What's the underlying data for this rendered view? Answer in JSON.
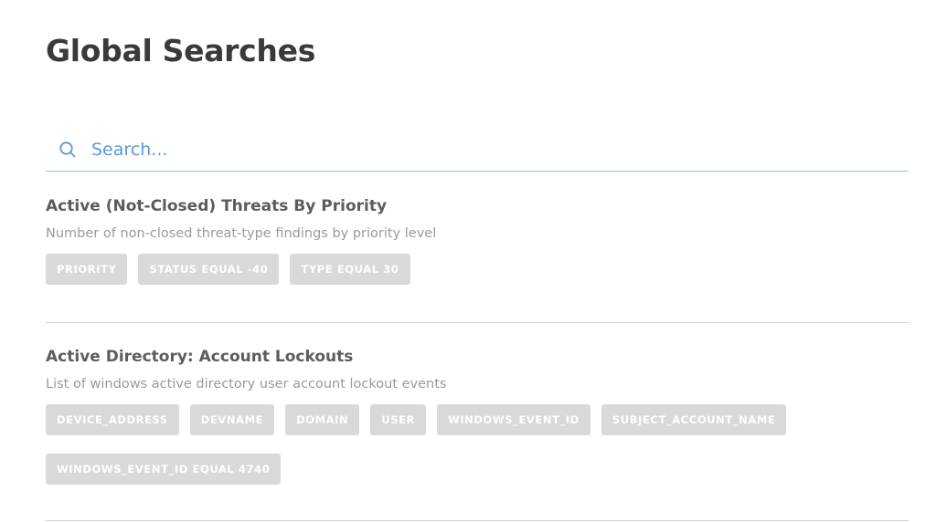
{
  "header": {
    "title": "Global Searches"
  },
  "search": {
    "placeholder": "Search...",
    "icon": "search-icon",
    "accent": "#5a9ad6"
  },
  "results": [
    {
      "title": "Active (Not-Closed) Threats By Priority",
      "description": "Number of non-closed threat-type findings by priority level",
      "tags": [
        "PRIORITY",
        "STATUS EQUAL -40",
        "TYPE EQUAL 30"
      ]
    },
    {
      "title": "Active Directory: Account Lockouts",
      "description": "List of windows active directory user account lockout events",
      "tags": [
        "DEVICE_ADDRESS",
        "DEVNAME",
        "DOMAIN",
        "USER",
        "WINDOWS_EVENT_ID",
        "SUBJECT_ACCOUNT_NAME",
        "WINDOWS_EVENT_ID EQUAL 4740"
      ]
    }
  ]
}
